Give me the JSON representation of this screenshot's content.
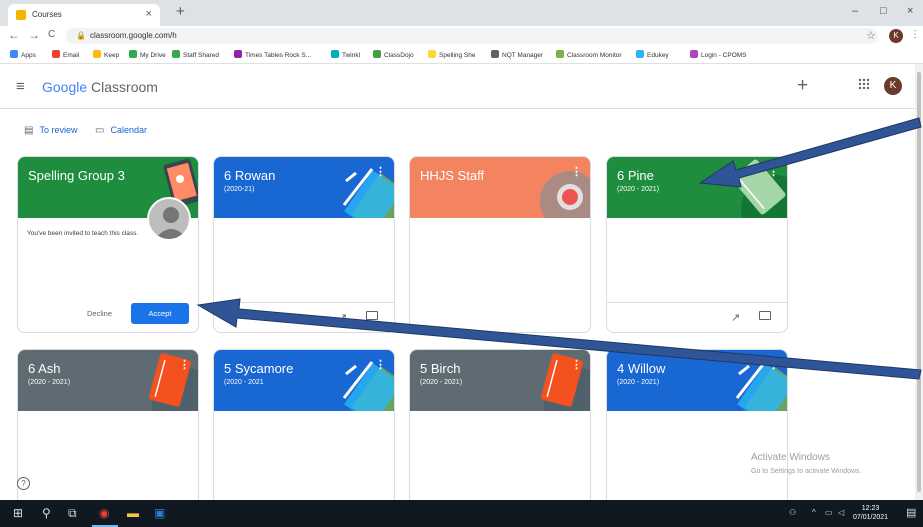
{
  "browser": {
    "tab_title": "Courses",
    "tab_close": "×",
    "new_tab": "+",
    "minimize": "–",
    "maximize": "□",
    "close": "×",
    "back": "←",
    "forward": "→",
    "reload": "C",
    "url": "classroom.google.com/h",
    "star": "☆",
    "profile_initial": "K",
    "menu": "⋮"
  },
  "bookmarks": [
    {
      "label": "Apps",
      "color": "#4285f4"
    },
    {
      "label": "Email",
      "color": "#ea4335"
    },
    {
      "label": "Keep",
      "color": "#fbbc05"
    },
    {
      "label": "My Drive",
      "color": "#34a853"
    },
    {
      "label": "Staff Shared",
      "color": "#34a853"
    },
    {
      "label": "Times Tables Rock S...",
      "color": "#8e24aa"
    },
    {
      "label": "Twinkl",
      "color": "#00acc1"
    },
    {
      "label": "ClassDojo",
      "color": "#43a047"
    },
    {
      "label": "Spelling She",
      "color": "#fdd835"
    },
    {
      "label": "NQT Manager",
      "color": "#616161"
    },
    {
      "label": "Classroom Monitor",
      "color": "#7cb342"
    },
    {
      "label": "Edukey",
      "color": "#29b6f6"
    },
    {
      "label": "Login - CPOMS",
      "color": "#ab47bc"
    }
  ],
  "header": {
    "brand_google": "Google",
    "brand_product": " Classroom",
    "add": "+",
    "apps": "⋮⋮⋮",
    "avatar_initial": "K"
  },
  "subnav": {
    "to_review": "To review",
    "calendar": "Calendar"
  },
  "cards": [
    {
      "title": "Spelling Group 3",
      "subtitle": "",
      "color": "#1e8e3e",
      "invite_text": "You've been invited to teach this class.",
      "decline": "Decline",
      "accept": "Accept"
    },
    {
      "title": "6 Rowan",
      "subtitle": "(2020-21)",
      "color": "#1967d2"
    },
    {
      "title": "HHJS Staff",
      "subtitle": "",
      "color": "#f4845f"
    },
    {
      "title": "6 Pine",
      "subtitle": "(2020 - 2021)",
      "color": "#1e8e3e"
    },
    {
      "title": "6 Ash",
      "subtitle": "(2020 - 2021)",
      "color": "#5f6b73"
    },
    {
      "title": "5 Sycamore",
      "subtitle": "(2020 - 2021",
      "color": "#1967d2"
    },
    {
      "title": "5 Birch",
      "subtitle": "(2020 - 2021)",
      "color": "#5f6b73"
    },
    {
      "title": "4 Willow",
      "subtitle": "(2020 - 2021)",
      "color": "#1967d2"
    }
  ],
  "watermark": {
    "line1": "Activate Windows",
    "line2": "Go to Settings to activate Windows."
  },
  "help": "?",
  "taskbar": {
    "time": "12:23",
    "date": "07/01/2021"
  }
}
